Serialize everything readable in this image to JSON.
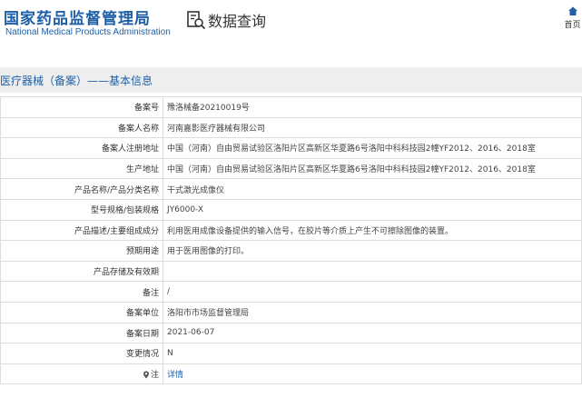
{
  "header": {
    "logo_cn": "国家药品监督管理局",
    "logo_en": "National Medical Products Administration",
    "query_label": "数据查询",
    "home_label": "首页"
  },
  "section": {
    "title": "医疗器械（备案）——基本信息"
  },
  "rows": [
    {
      "label": "备案号",
      "value": "豫洛械备20210019号"
    },
    {
      "label": "备案人名称",
      "value": "河南嘉影医疗器械有限公司"
    },
    {
      "label": "备案人注册地址",
      "value": "中国（河南）自由贸易试验区洛阳片区高新区华夏路6号洛阳中科科技园2幢YF2012、2016、2018室"
    },
    {
      "label": "生产地址",
      "value": "中国（河南）自由贸易试验区洛阳片区高新区华夏路6号洛阳中科科技园2幢YF2012、2016、2018室"
    },
    {
      "label": "产品名称/产品分类名称",
      "value": "干式激光成像仪"
    },
    {
      "label": "型号规格/包装规格",
      "value": "JY6000-X"
    },
    {
      "label": "产品描述/主要组成成分",
      "value": "利用医用成像设备提供的输入信号，在胶片等介质上产生不可擦除图像的装置。"
    },
    {
      "label": "预期用途",
      "value": "用于医用图像的打印。"
    },
    {
      "label": "产品存储及有效期",
      "value": ""
    },
    {
      "label": "备注",
      "value": "/"
    },
    {
      "label": "备案单位",
      "value": "洛阳市市场监督管理局"
    },
    {
      "label": "备案日期",
      "value": "2021-06-07"
    },
    {
      "label": "变更情况",
      "value": "N"
    },
    {
      "label": "注",
      "value": "详情"
    }
  ],
  "colors": {
    "brand": "#1f5fa8",
    "bar_bg": "#eeeeee",
    "border": "#dddddd"
  },
  "icons": {
    "query": "search-document-icon",
    "home": "home-icon",
    "note": "map-pin-icon"
  }
}
